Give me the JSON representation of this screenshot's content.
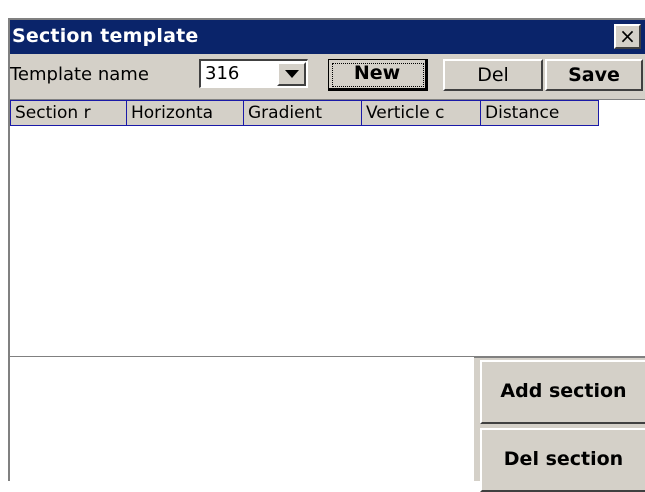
{
  "window": {
    "title": "Section template",
    "close_symbol": "×"
  },
  "toolbar": {
    "template_label": "Template name",
    "template_value": "316",
    "new_label": "New",
    "del_label": "Del",
    "save_label": "Save"
  },
  "grid": {
    "columns": [
      "Section r",
      "Horizonta",
      "Gradient",
      "Verticle c",
      "Distance"
    ],
    "rows": []
  },
  "actions": {
    "add_section": "Add section",
    "del_section": "Del section"
  },
  "colors": {
    "titlebar": "#0a246a",
    "face": "#d4d0c8",
    "header_border": "#1a1aa8"
  }
}
